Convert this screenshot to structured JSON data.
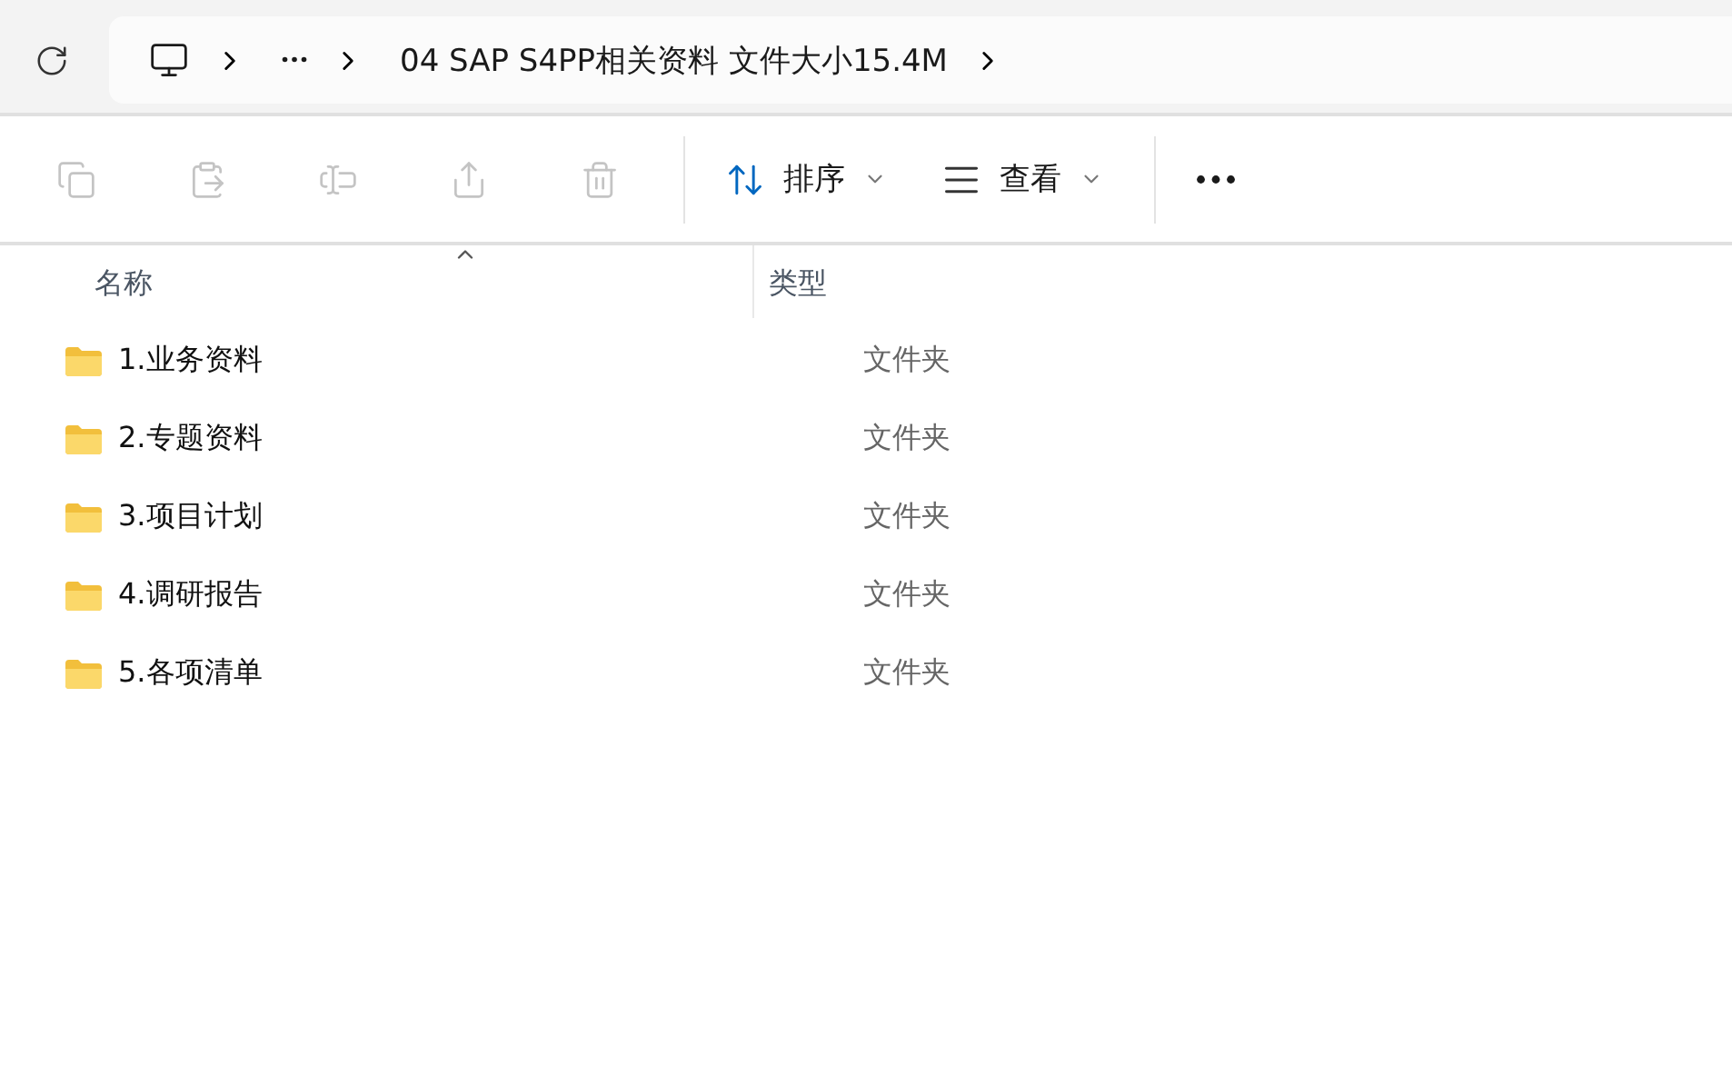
{
  "address_bar": {
    "path": [
      {
        "kind": "device"
      },
      {
        "kind": "overflow"
      },
      {
        "kind": "folder",
        "label": "04 SAP S4PP相关资料 文件大小15.4M"
      }
    ]
  },
  "toolbar": {
    "actions": [
      {
        "kind": "copy",
        "disabled": true
      },
      {
        "kind": "paste",
        "disabled": true
      },
      {
        "kind": "rename",
        "disabled": true
      },
      {
        "kind": "share",
        "disabled": true
      },
      {
        "kind": "delete",
        "disabled": true
      }
    ],
    "menus": [
      {
        "kind": "sort",
        "label": "排序"
      },
      {
        "kind": "view",
        "label": "查看"
      }
    ]
  },
  "table": {
    "columns": [
      {
        "label": "名称",
        "sorted": true
      },
      {
        "label": "类型",
        "sorted": false
      }
    ],
    "rows": [
      {
        "name": "1.业务资料",
        "type": "文件夹"
      },
      {
        "name": "2.专题资料",
        "type": "文件夹"
      },
      {
        "name": "3.项目计划",
        "type": "文件夹"
      },
      {
        "name": "4.调研报告",
        "type": "文件夹"
      },
      {
        "name": "5.各项清单",
        "type": "文件夹"
      }
    ]
  }
}
